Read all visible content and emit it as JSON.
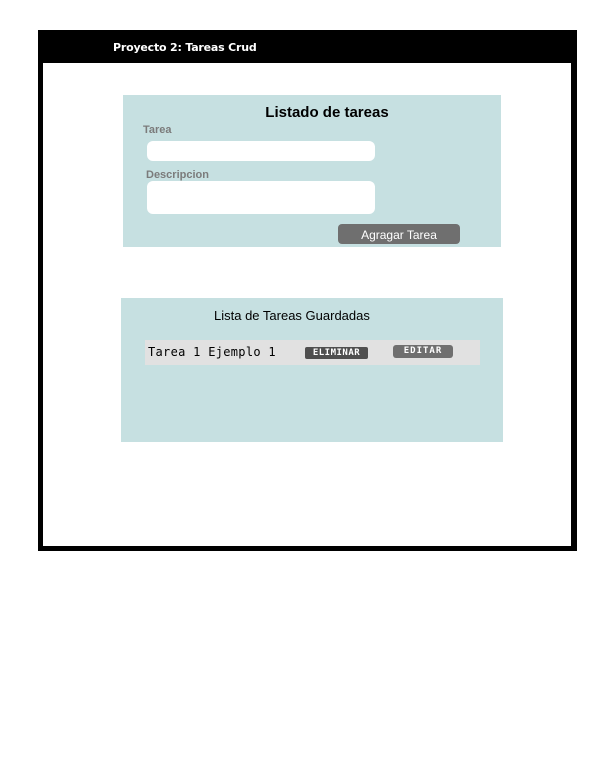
{
  "window": {
    "title": "Proyecto 2: Tareas Crud"
  },
  "form": {
    "heading": "Listado de tareas",
    "task_label": "Tarea",
    "task_value": "",
    "description_label": "Descripcion",
    "description_value": "",
    "add_button_label": "Agragar Tarea"
  },
  "saved_list": {
    "heading": "Lista de Tareas Guardadas",
    "items": [
      {
        "text": "Tarea 1  Ejemplo 1",
        "delete_label": "ELIMINAR",
        "edit_label": "EDITAR"
      }
    ]
  },
  "colors": {
    "frame": "#000000",
    "panel": "#c6e0e1",
    "button": "#6f6f6f",
    "row": "#e1e1e1"
  }
}
